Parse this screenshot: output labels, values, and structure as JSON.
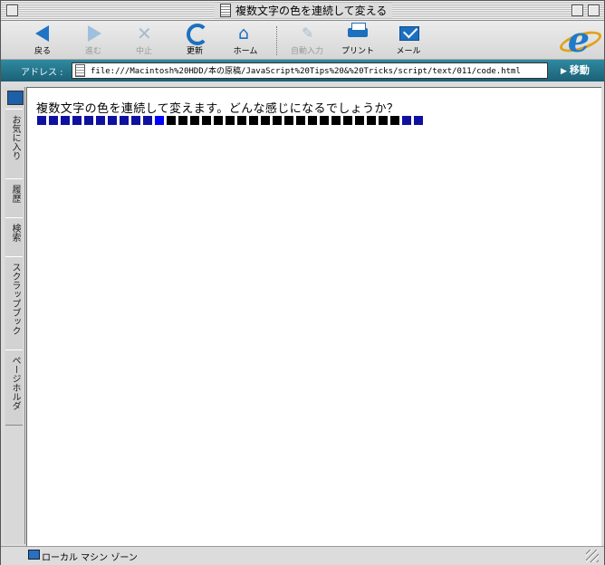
{
  "window": {
    "title": "複数文字の色を連続して変える"
  },
  "toolbar": {
    "buttons": [
      {
        "label": "戻る",
        "icon": "back-arrow-icon",
        "enabled": true
      },
      {
        "label": "進む",
        "icon": "forward-arrow-icon",
        "enabled": false
      },
      {
        "label": "中止",
        "icon": "stop-icon",
        "enabled": false
      },
      {
        "label": "更新",
        "icon": "refresh-icon",
        "enabled": true
      },
      {
        "label": "ホーム",
        "icon": "home-icon",
        "enabled": true
      },
      {
        "label": "自動入力",
        "icon": "autofill-icon",
        "enabled": false
      },
      {
        "label": "プリント",
        "icon": "printer-icon",
        "enabled": true
      },
      {
        "label": "メール",
        "icon": "mail-icon",
        "enabled": true
      }
    ]
  },
  "address": {
    "label": "アドレス :",
    "url": "file:///Macintosh%20HDD/本の原稿/JavaScript%20Tips%20&%20Tricks/script/text/011/code.html",
    "go_label": "移動"
  },
  "sidebar": {
    "tabs": [
      "お気に入り",
      "履歴",
      "検索",
      "スクラップブック",
      "ページホルダ"
    ]
  },
  "page": {
    "text": "複数文字の色を連続して変えます。どんな感じになるでしょうか？",
    "squares": [
      "#1010a0",
      "#1010a0",
      "#1010a0",
      "#1010a0",
      "#1010a0",
      "#1010a0",
      "#1010a0",
      "#1010a0",
      "#1010a0",
      "#1010a0",
      "#0000ff",
      "#000000",
      "#000000",
      "#000000",
      "#000000",
      "#000000",
      "#000000",
      "#000000",
      "#000000",
      "#000000",
      "#000000",
      "#000000",
      "#000000",
      "#000000",
      "#000000",
      "#000000",
      "#000000",
      "#000000",
      "#000000",
      "#000000",
      "#000000",
      "#1010a0",
      "#1010a0"
    ]
  },
  "status": {
    "zone": "ローカル マシン ゾーン"
  },
  "colors": {
    "accent": "#1d6fbf",
    "address_bar": "#2f8aa0"
  }
}
